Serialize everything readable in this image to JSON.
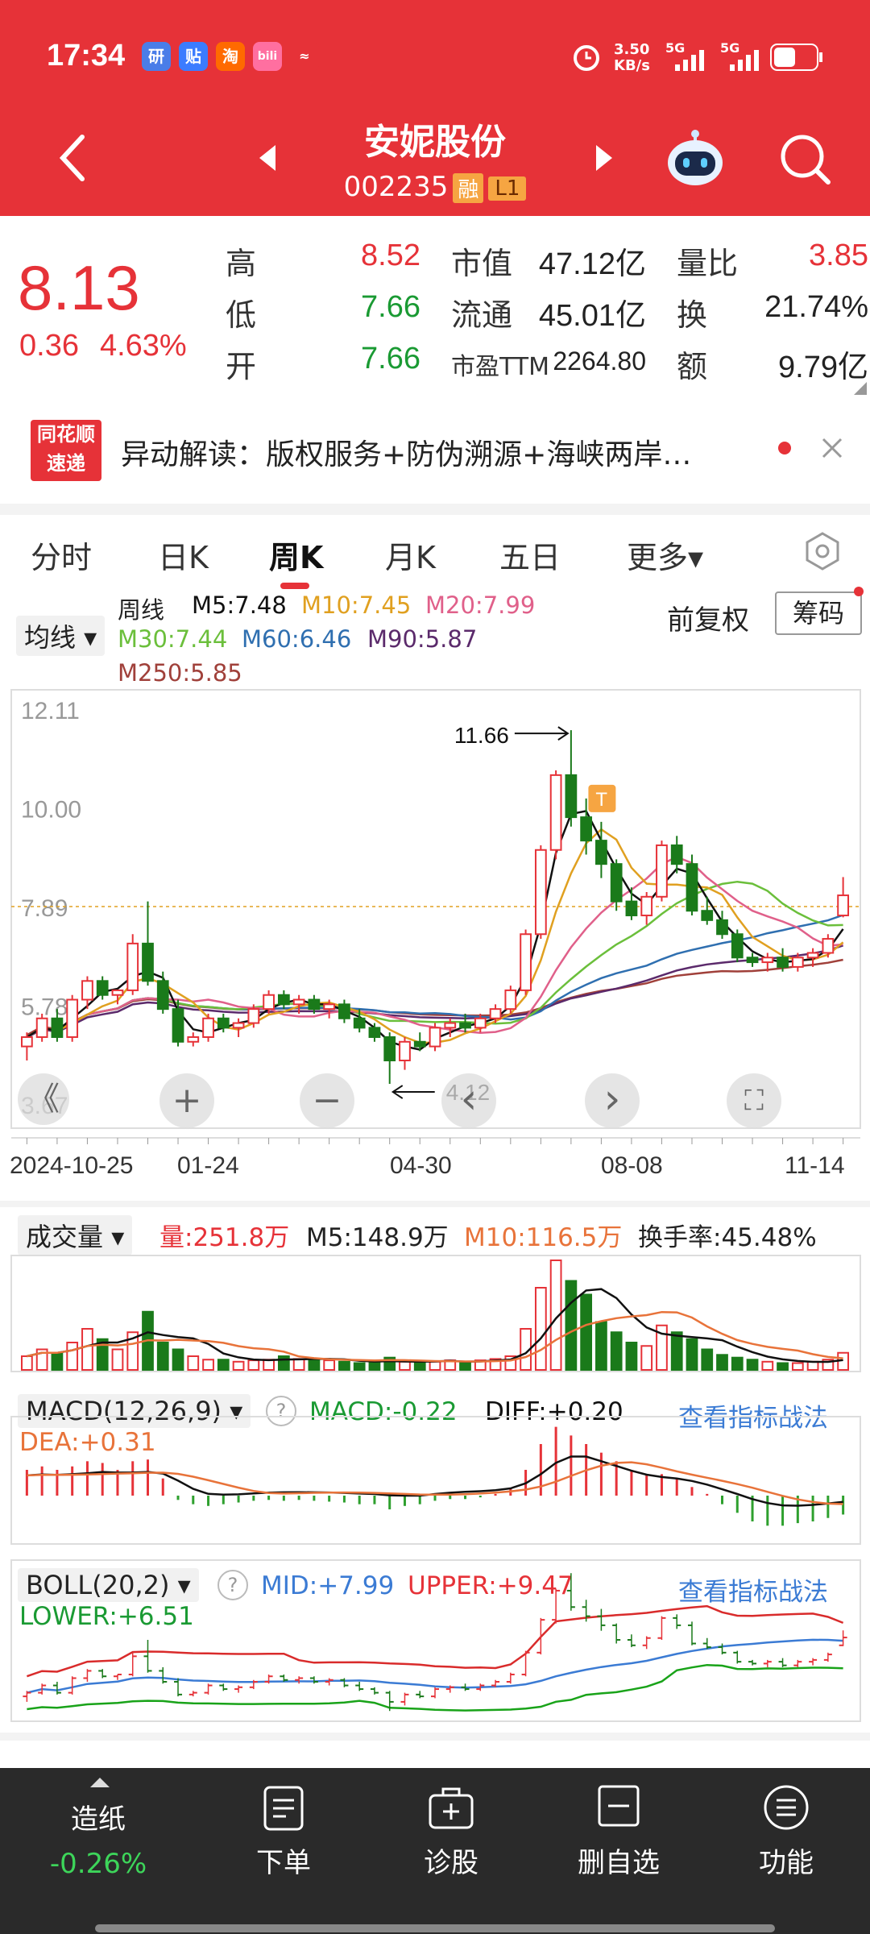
{
  "status": {
    "time": "17:34",
    "net_speed": "3.50\nKB/s",
    "net_speed_text": "3.50 KB/s",
    "signal1": "5G",
    "signal2": "5G",
    "app_icons": [
      "研",
      "贴",
      "淘",
      "bili",
      "≈"
    ]
  },
  "header": {
    "title": "安妮股份",
    "code": "002235",
    "tag_rong": "融",
    "tag_level": "L1"
  },
  "quote": {
    "price": "8.13",
    "change": "0.36",
    "change_pct": "4.63%",
    "high_label": "高",
    "high": "8.52",
    "low_label": "低",
    "low": "7.66",
    "open_label": "开",
    "open": "7.66",
    "mktcap_label": "市值",
    "mktcap": "47.12亿",
    "float_label": "流通",
    "float": "45.01亿",
    "pe_label": "市盈TTM",
    "pe": "2264.80",
    "vol_ratio_label": "量比",
    "vol_ratio": "3.85",
    "turnover_label": "换",
    "turnover": "21.74%",
    "amount_label": "额",
    "amount": "9.79亿"
  },
  "news": {
    "logo_line1": "同花顺",
    "logo_line2": "速递",
    "text": "异动解读：版权服务+防伪溯源+海峡两岸…"
  },
  "tabs": [
    "分时",
    "日K",
    "周K",
    "月K",
    "五日",
    "更多▾"
  ],
  "active_tab": "周K",
  "ma_legend": {
    "selector": "均线 ▾",
    "period": "周线",
    "m5": "M5:7.48",
    "m10": "M10:7.45",
    "m20": "M20:7.99",
    "m30": "M30:7.44",
    "m60": "M60:6.46",
    "m90": "M90:5.87",
    "m250": "M250:5.85",
    "fq": "前复权",
    "chip": "筹码"
  },
  "colors": {
    "brand": "#e63238",
    "up": "#e63238",
    "down": "#1a7a1a",
    "m5": "#111111",
    "m10": "#e0a020",
    "m20": "#e0608a",
    "m30": "#6bbf3b",
    "m60": "#2f6fb0",
    "m90": "#5b2a6b",
    "m250": "#a0403a"
  },
  "chart_data": [
    {
      "type": "candlestick",
      "title": "周K",
      "y_ticks": [
        "12.11",
        "10.00",
        "7.89",
        "5.78",
        "3.67"
      ],
      "x_ticks": [
        "2024-10-25",
        "01-24",
        "04-30",
        "08-08",
        "11-14"
      ],
      "ylim": [
        3.67,
        12.11
      ],
      "annotations": {
        "high": "11.66",
        "low": "4.12",
        "marker": "T"
      },
      "last_close": 7.89,
      "candles": [
        [
          4.9,
          5.2,
          4.6,
          5.1
        ],
        [
          5.1,
          5.6,
          5.0,
          5.5
        ],
        [
          5.5,
          5.7,
          5.0,
          5.1
        ],
        [
          5.1,
          6.0,
          5.0,
          5.9
        ],
        [
          5.9,
          6.4,
          5.7,
          6.3
        ],
        [
          6.3,
          6.4,
          5.9,
          6.0
        ],
        [
          6.0,
          6.1,
          5.8,
          6.1
        ],
        [
          6.1,
          7.3,
          6.0,
          7.1
        ],
        [
          7.1,
          8.0,
          6.2,
          6.3
        ],
        [
          6.3,
          6.5,
          5.6,
          5.7
        ],
        [
          5.7,
          5.9,
          4.9,
          5.0
        ],
        [
          5.0,
          5.2,
          4.9,
          5.1
        ],
        [
          5.1,
          5.6,
          5.0,
          5.5
        ],
        [
          5.5,
          5.6,
          5.2,
          5.3
        ],
        [
          5.3,
          5.5,
          5.1,
          5.4
        ],
        [
          5.4,
          5.8,
          5.3,
          5.7
        ],
        [
          5.7,
          6.1,
          5.6,
          6.0
        ],
        [
          6.0,
          6.1,
          5.7,
          5.8
        ],
        [
          5.8,
          6.0,
          5.6,
          5.9
        ],
        [
          5.9,
          6.0,
          5.6,
          5.7
        ],
        [
          5.7,
          5.9,
          5.5,
          5.8
        ],
        [
          5.8,
          5.9,
          5.4,
          5.5
        ],
        [
          5.5,
          5.7,
          5.2,
          5.3
        ],
        [
          5.3,
          5.4,
          5.0,
          5.1
        ],
        [
          5.1,
          5.2,
          4.1,
          4.6
        ],
        [
          4.6,
          5.1,
          4.4,
          5.0
        ],
        [
          5.0,
          5.2,
          4.8,
          4.9
        ],
        [
          4.9,
          5.4,
          4.8,
          5.3
        ],
        [
          5.3,
          5.5,
          5.1,
          5.4
        ],
        [
          5.4,
          5.6,
          5.2,
          5.3
        ],
        [
          5.3,
          5.6,
          5.2,
          5.5
        ],
        [
          5.5,
          5.8,
          5.4,
          5.7
        ],
        [
          5.7,
          6.2,
          5.6,
          6.1
        ],
        [
          6.1,
          7.4,
          6.0,
          7.3
        ],
        [
          7.3,
          9.2,
          7.2,
          9.1
        ],
        [
          9.1,
          10.8,
          8.9,
          10.7
        ],
        [
          10.7,
          11.66,
          9.6,
          9.8
        ],
        [
          9.8,
          10.2,
          9.0,
          9.3
        ],
        [
          9.3,
          9.7,
          8.5,
          8.8
        ],
        [
          8.8,
          8.9,
          7.8,
          8.0
        ],
        [
          8.0,
          8.3,
          7.6,
          7.7
        ],
        [
          7.7,
          8.2,
          7.5,
          8.1
        ],
        [
          8.1,
          9.3,
          8.0,
          9.2
        ],
        [
          9.2,
          9.4,
          8.6,
          8.8
        ],
        [
          8.8,
          9.0,
          7.7,
          7.8
        ],
        [
          7.8,
          8.1,
          7.5,
          7.6
        ],
        [
          7.6,
          7.8,
          7.2,
          7.3
        ],
        [
          7.3,
          7.4,
          6.7,
          6.8
        ],
        [
          6.8,
          6.9,
          6.6,
          6.7
        ],
        [
          6.7,
          6.9,
          6.5,
          6.8
        ],
        [
          6.8,
          7.0,
          6.5,
          6.6
        ],
        [
          6.6,
          6.9,
          6.5,
          6.8
        ],
        [
          6.8,
          7.0,
          6.6,
          6.9
        ],
        [
          6.9,
          7.3,
          6.8,
          7.2
        ],
        [
          7.7,
          8.52,
          7.66,
          8.13
        ]
      ]
    },
    {
      "type": "bar",
      "title": "成交量",
      "series_label": "量:251.8万",
      "m5_label": "M5:148.9万",
      "m10_label": "M10:116.5万",
      "turnover_label": "换手率:45.48%",
      "values": [
        20,
        30,
        25,
        40,
        60,
        45,
        30,
        55,
        85,
        40,
        30,
        20,
        15,
        15,
        12,
        14,
        15,
        20,
        16,
        15,
        14,
        12,
        10,
        10,
        18,
        12,
        10,
        12,
        14,
        12,
        14,
        16,
        20,
        60,
        120,
        160,
        130,
        110,
        70,
        55,
        40,
        35,
        65,
        55,
        45,
        30,
        22,
        18,
        15,
        12,
        10,
        10,
        12,
        15,
        25
      ]
    },
    {
      "type": "line",
      "title": "MACD(12,26,9)",
      "labels": {
        "macd": "MACD:-0.22",
        "diff": "DIFF:+0.20",
        "dea": "DEA:+0.31",
        "link": "查看指标战法"
      },
      "macd": [
        0.3,
        0.34,
        0.3,
        0.34,
        0.4,
        0.38,
        0.3,
        0.4,
        0.42,
        0.2,
        -0.05,
        -0.1,
        -0.12,
        -0.1,
        -0.08,
        -0.06,
        -0.05,
        -0.06,
        -0.05,
        -0.06,
        -0.07,
        -0.08,
        -0.1,
        -0.1,
        -0.16,
        -0.12,
        -0.1,
        -0.06,
        -0.04,
        -0.04,
        -0.02,
        0.02,
        0.08,
        0.3,
        0.6,
        0.8,
        0.7,
        0.6,
        0.5,
        0.4,
        0.3,
        0.25,
        0.25,
        0.2,
        0.1,
        0.02,
        -0.1,
        -0.2,
        -0.3,
        -0.35,
        -0.35,
        -0.32,
        -0.3,
        -0.26,
        -0.22
      ]
    },
    {
      "type": "line",
      "title": "BOLL(20,2)",
      "labels": {
        "mid": "MID:+7.99",
        "upper": "UPPER:+9.47",
        "lower": "LOWER:+6.51",
        "link": "查看指标战法"
      }
    }
  ],
  "nav_buttons": {
    "back": "《",
    "plus": "+",
    "minus": "−",
    "prev": "‹",
    "next": "›",
    "fullscreen": "⛶"
  },
  "bottom_bar": {
    "paper_label": "造纸",
    "paper_change": "-0.26%",
    "order": "下单",
    "diagnose": "诊股",
    "remove_fav": "删自选",
    "functions": "功能"
  }
}
